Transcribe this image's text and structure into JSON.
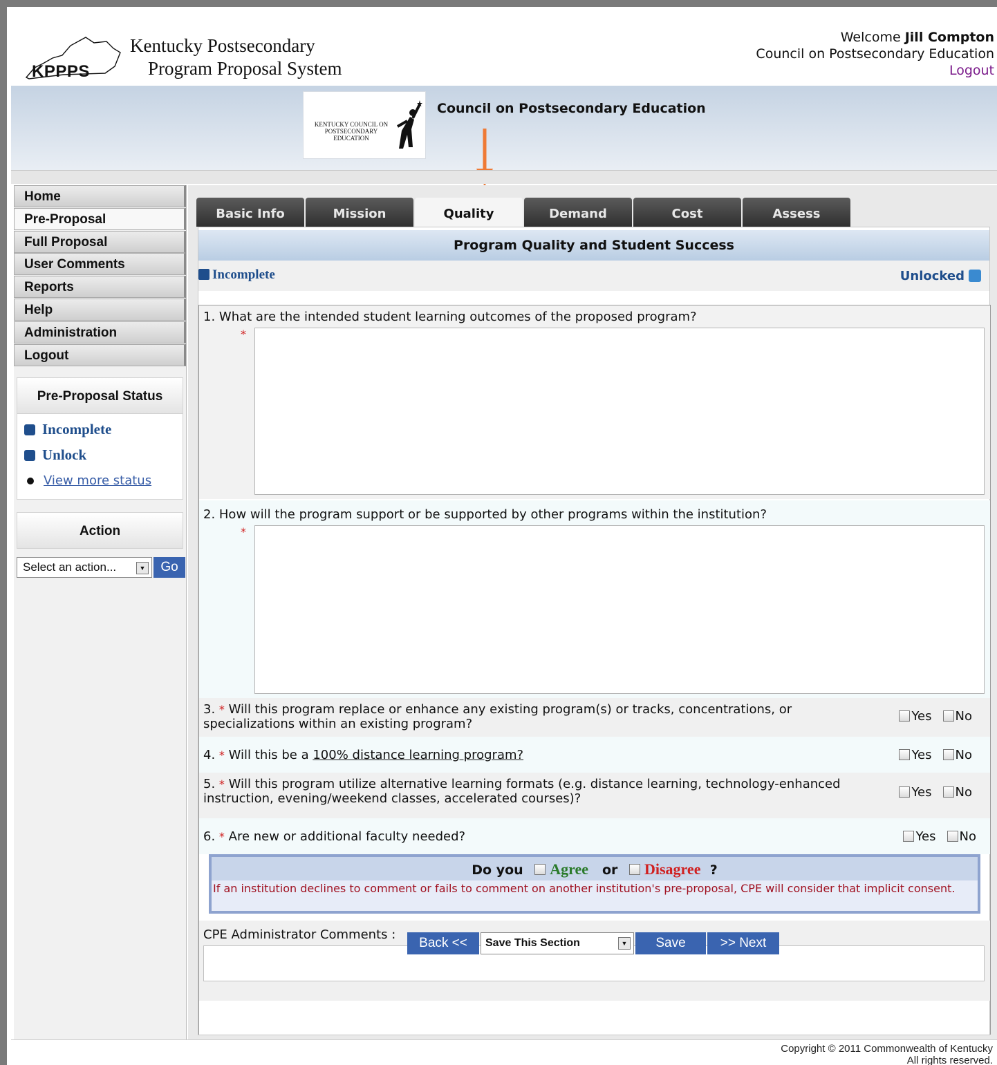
{
  "header": {
    "logo_text": "KPPPS",
    "system_title_line1": "Kentucky Postsecondary",
    "system_title_line2": "Program Proposal System",
    "welcome_prefix": "Welcome",
    "user_name": "Jill Compton",
    "organization": "Council on Postsecondary Education",
    "logout": "Logout"
  },
  "banner": {
    "logo_text_line1": "KENTUCKY COUNCIL ON",
    "logo_text_line2": "POSTSECONDARY EDUCATION",
    "title": "Council on Postsecondary Education"
  },
  "sidebar": {
    "nav": [
      {
        "label": "Home"
      },
      {
        "label": "Pre-Proposal"
      },
      {
        "label": "Full Proposal"
      },
      {
        "label": "User Comments"
      },
      {
        "label": "Reports"
      },
      {
        "label": "Help"
      },
      {
        "label": "Administration"
      },
      {
        "label": "Logout"
      }
    ],
    "status_panel": {
      "title": "Pre-Proposal Status",
      "incomplete": "Incomplete",
      "unlock": "Unlock",
      "view_more": "View more status"
    },
    "action_panel": {
      "title": "Action",
      "select_value": "Select an action...",
      "go": "Go"
    }
  },
  "tabs": [
    {
      "label": "Basic Info"
    },
    {
      "label": "Mission"
    },
    {
      "label": "Quality"
    },
    {
      "label": "Demand"
    },
    {
      "label": "Cost"
    },
    {
      "label": "Assess"
    }
  ],
  "section": {
    "title": "Program Quality and Student Success",
    "status_left": "Incomplete",
    "status_right": "Unlocked"
  },
  "questions": {
    "q1": "1. What are the intended student learning outcomes of the proposed program?",
    "q2": "2. How will the program support or be supported by other programs within the institution?",
    "q3_num": "3.",
    "q3_text": "Will this program replace or enhance any existing program(s) or tracks, concentrations, or specializations within an existing program?",
    "q4_num": "4.",
    "q4_text": "Will this be a",
    "q4_link": "100% distance learning program?",
    "q5_num": "5.",
    "q5_text": "Will this program utilize alternative learning formats (e.g. distance learning, technology-enhanced instruction, evening/weekend classes, accelerated courses)?",
    "q6_num": "6.",
    "q6_text": "Are new or additional faculty needed?",
    "required_mark": "*",
    "yes": "Yes",
    "no": "No"
  },
  "agree": {
    "do_you": "Do you",
    "agree": "Agree",
    "or": "or",
    "disagree": "Disagree",
    "qmark": "?",
    "note": "If an institution declines to comment or fails to comment on another institution's pre-proposal, CPE will consider that implicit consent."
  },
  "comments": {
    "label": "CPE Administrator Comments :"
  },
  "buttons": {
    "back": "Back <<",
    "save_select": "Save This Section",
    "save": "Save",
    "next": ">> Next"
  },
  "footer": {
    "line1": "Copyright © 2011 Commonwealth of Kentucky",
    "line2": "All rights reserved."
  }
}
